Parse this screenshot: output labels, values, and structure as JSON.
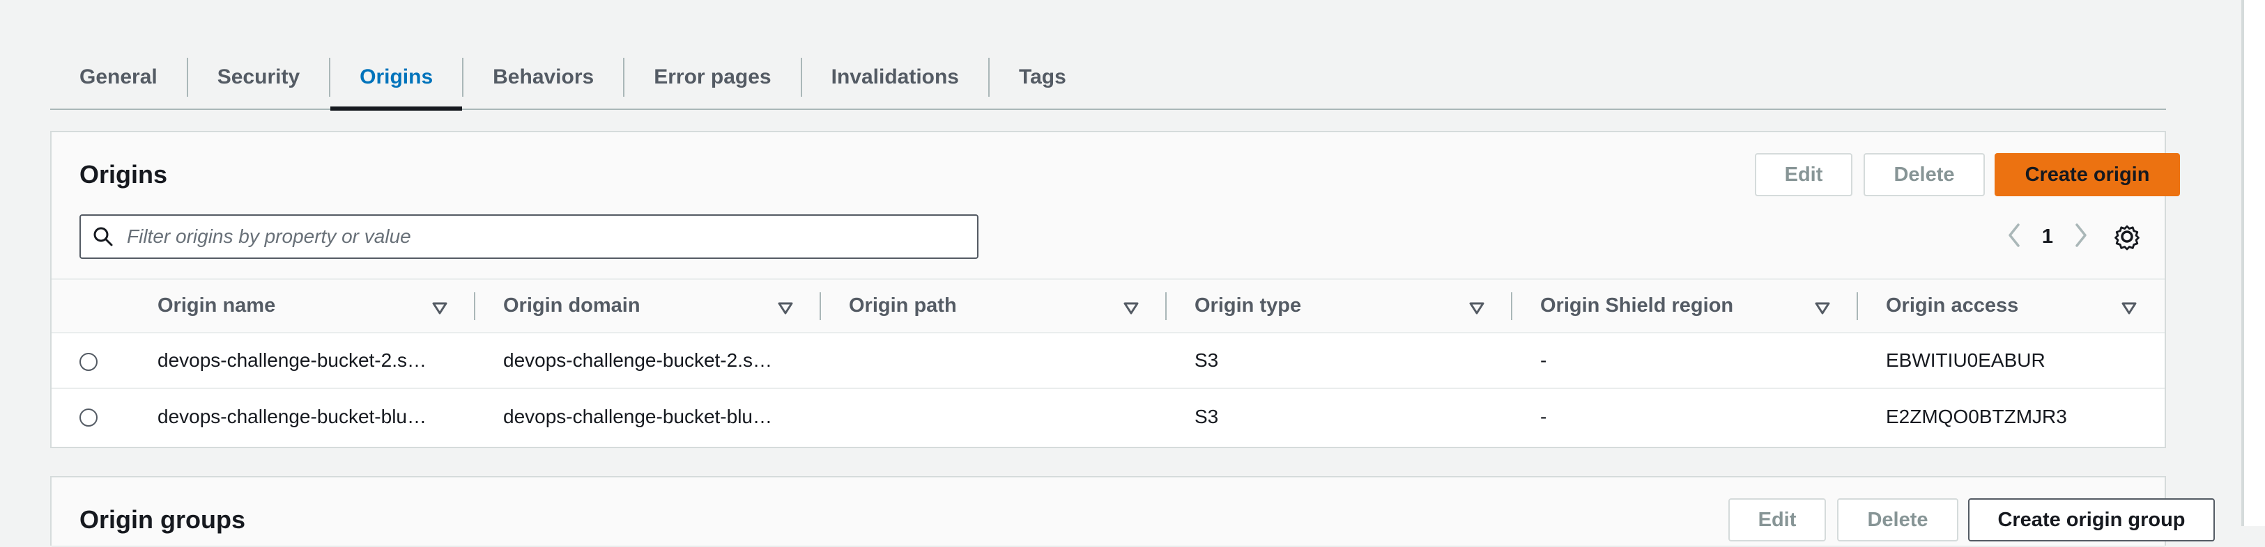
{
  "tabs": [
    {
      "label": "General"
    },
    {
      "label": "Security"
    },
    {
      "label": "Origins",
      "active": true
    },
    {
      "label": "Behaviors"
    },
    {
      "label": "Error pages"
    },
    {
      "label": "Invalidations"
    },
    {
      "label": "Tags"
    }
  ],
  "origins": {
    "title": "Origins",
    "edit_label": "Edit",
    "delete_label": "Delete",
    "create_label": "Create origin",
    "search_placeholder": "Filter origins by property or value",
    "page": "1",
    "columns": [
      "Origin name",
      "Origin domain",
      "Origin path",
      "Origin type",
      "Origin Shield region",
      "Origin access"
    ],
    "rows": [
      {
        "name": "devops-challenge-bucket-2.s…",
        "domain": "devops-challenge-bucket-2.s…",
        "path": "",
        "type": "S3",
        "shield": "-",
        "access": "EBWITIU0EABUR"
      },
      {
        "name": "devops-challenge-bucket-blu…",
        "domain": "devops-challenge-bucket-blu…",
        "path": "",
        "type": "S3",
        "shield": "-",
        "access": "E2ZMQO0BTZMJR3"
      }
    ]
  },
  "origin_groups": {
    "title": "Origin groups",
    "edit_label": "Edit",
    "delete_label": "Delete",
    "create_label": "Create origin group"
  },
  "colors": {
    "accent": "#0073bb",
    "primary_button": "#ec7211"
  }
}
